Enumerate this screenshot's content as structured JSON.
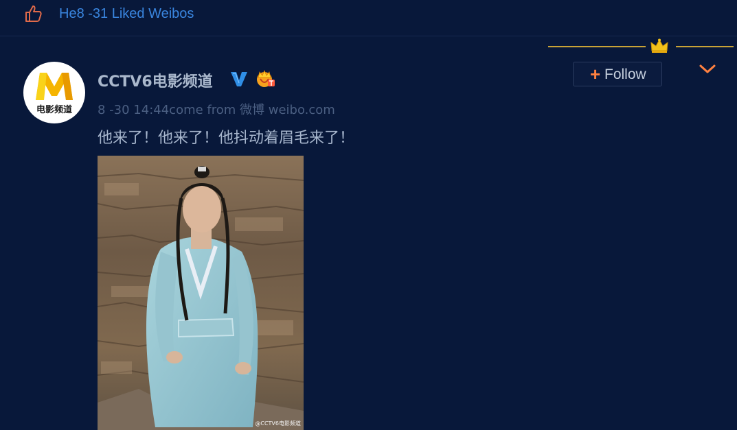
{
  "likes_header": {
    "icon": "thumbs-up-icon",
    "title": "He8 -31 Liked Weibos"
  },
  "post": {
    "author": {
      "name": "CCTV6电影频道",
      "avatar_text": "电影频道",
      "verified_icon": "verified-v-icon",
      "vip_icon": "vip-crown-badge-icon"
    },
    "timestamp": "8 -30 14:44",
    "source": "come from 微博 weibo.com",
    "text": "他来了！他来了！他抖动着眉毛来了！",
    "image": {
      "description_icon": "photo",
      "watermark": "@CCTV6电影频道"
    }
  },
  "actions": {
    "follow_plus": "+",
    "follow_label": "Follow",
    "more_icon": "chevron-down-icon"
  },
  "colors": {
    "background": "#08183a",
    "link_blue": "#3a86e0",
    "accent_orange": "#ff8140",
    "gold": "#c9a336"
  }
}
